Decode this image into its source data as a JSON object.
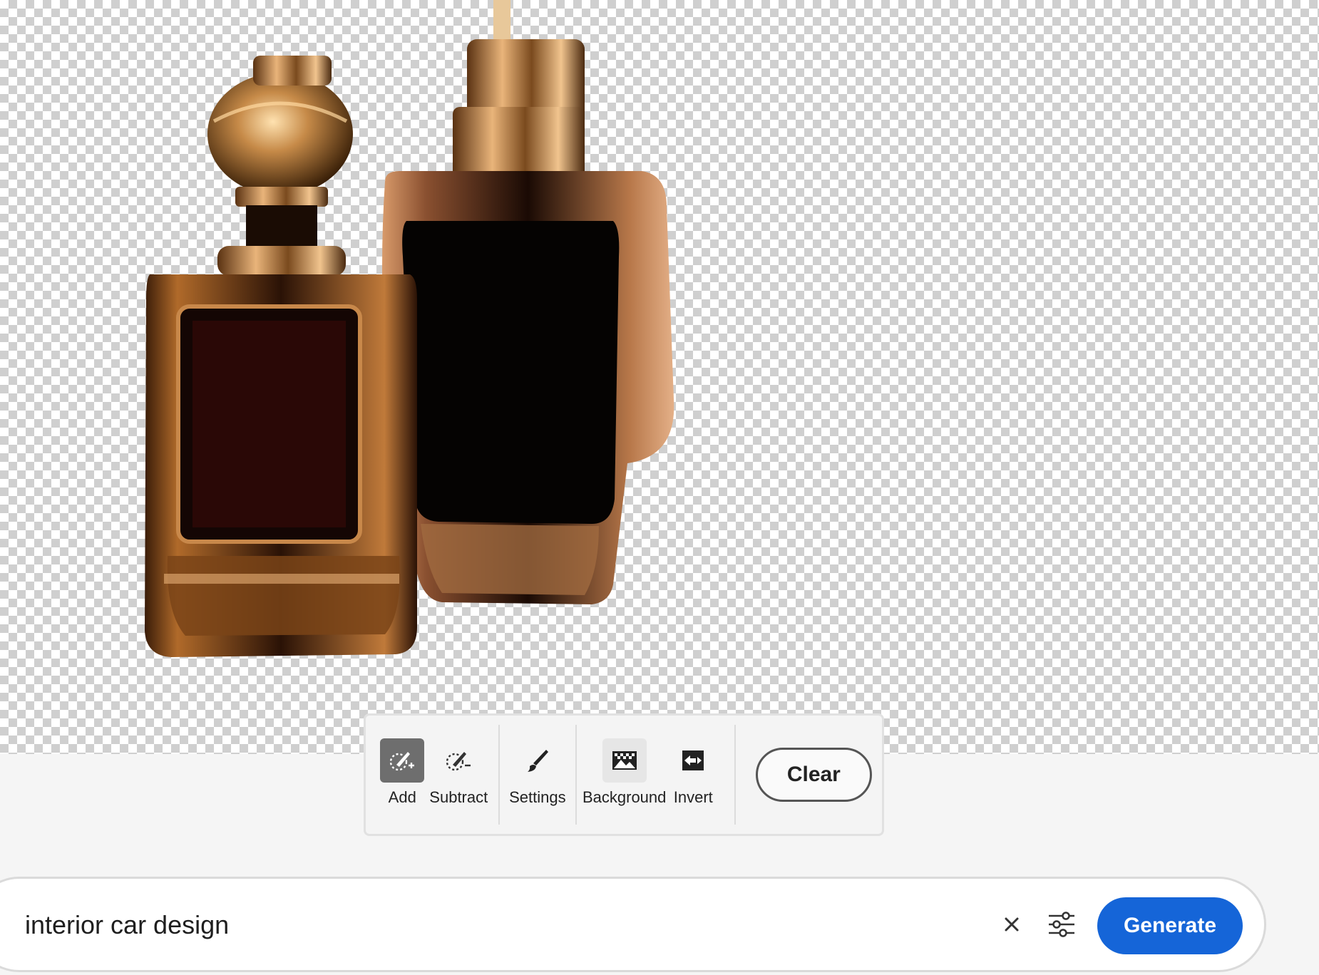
{
  "canvas": {
    "subject": "two perfume bottles with transparent background"
  },
  "toolbar": {
    "tools": [
      {
        "id": "add",
        "label": "Add",
        "icon": "brush-add-icon",
        "active": true
      },
      {
        "id": "subtract",
        "label": "Subtract",
        "icon": "brush-subtract-icon",
        "active": false
      },
      {
        "id": "settings",
        "label": "Settings",
        "icon": "brush-icon",
        "active": false
      },
      {
        "id": "background",
        "label": "Background",
        "icon": "image-background-icon",
        "active": false
      },
      {
        "id": "invert",
        "label": "Invert",
        "icon": "invert-icon",
        "active": false
      }
    ],
    "clear_label": "Clear"
  },
  "prompt": {
    "value": "interior car design",
    "clear_icon": "close-icon",
    "settings_icon": "sliders-icon",
    "generate_label": "Generate"
  },
  "colors": {
    "accent": "#1565d8",
    "active_tool": "#6e6e6e"
  }
}
